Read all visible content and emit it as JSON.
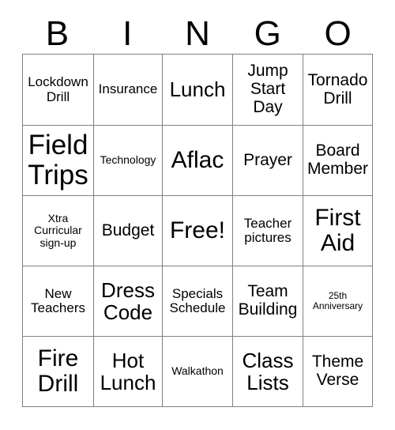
{
  "card": {
    "header": {
      "letters": [
        "B",
        "I",
        "N",
        "G",
        "O"
      ]
    },
    "rows": [
      [
        {
          "text": "Lockdown Drill",
          "size": "fs-sm"
        },
        {
          "text": "Insurance",
          "size": "fs-sm"
        },
        {
          "text": "Lunch",
          "size": "fs-lg"
        },
        {
          "text": "Jump Start Day",
          "size": "fs-md"
        },
        {
          "text": "Tornado Drill",
          "size": "fs-md"
        }
      ],
      [
        {
          "text": "Field Trips",
          "size": "fs-xxl"
        },
        {
          "text": "Technology",
          "size": "fs-xs"
        },
        {
          "text": "Aflac",
          "size": "fs-xl"
        },
        {
          "text": "Prayer",
          "size": "fs-md"
        },
        {
          "text": "Board Member",
          "size": "fs-md"
        }
      ],
      [
        {
          "text": "Xtra Curricular sign-up",
          "size": "fs-xs"
        },
        {
          "text": "Budget",
          "size": "fs-md"
        },
        {
          "text": "Free!",
          "size": "fs-xl"
        },
        {
          "text": "Teacher pictures",
          "size": "fs-sm"
        },
        {
          "text": "First Aid",
          "size": "fs-xl"
        }
      ],
      [
        {
          "text": "New Teachers",
          "size": "fs-sm"
        },
        {
          "text": "Dress Code",
          "size": "fs-lg"
        },
        {
          "text": "Specials Schedule",
          "size": "fs-sm"
        },
        {
          "text": "Team Building",
          "size": "fs-md"
        },
        {
          "text": "25th Anniversary",
          "size": "fs-xxs"
        }
      ],
      [
        {
          "text": "Fire Drill",
          "size": "fs-xl"
        },
        {
          "text": "Hot Lunch",
          "size": "fs-lg"
        },
        {
          "text": "Walkathon",
          "size": "fs-xs"
        },
        {
          "text": "Class Lists",
          "size": "fs-lg"
        },
        {
          "text": "Theme Verse",
          "size": "fs-md"
        }
      ]
    ],
    "colors": {
      "border": "#808080",
      "text": "#000000",
      "background": "#ffffff"
    }
  }
}
